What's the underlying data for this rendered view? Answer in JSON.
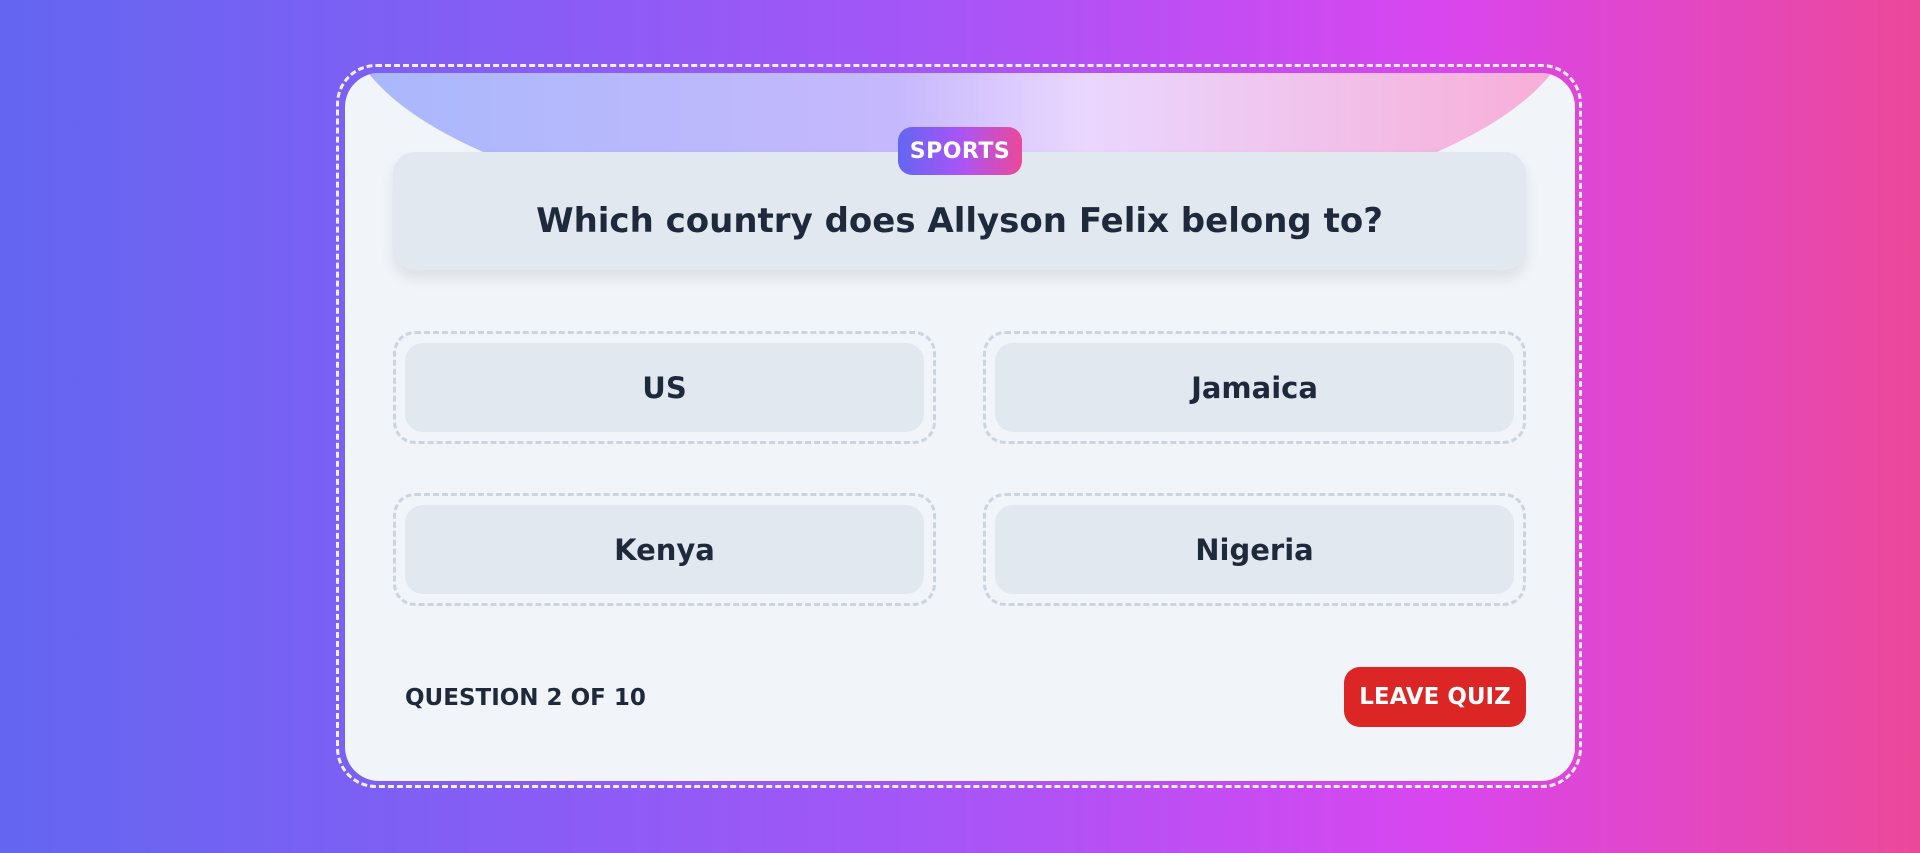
{
  "quiz": {
    "category": "SPORTS",
    "question": "Which country does Allyson Felix belong to?",
    "options": [
      {
        "label": "US"
      },
      {
        "label": "Jamaica"
      },
      {
        "label": "Kenya"
      },
      {
        "label": "Nigeria"
      }
    ],
    "progress": "QUESTION 2 OF 10",
    "leave_label": "LEAVE QUIZ"
  },
  "colors": {
    "accent_danger": "#dc2626",
    "card_bg": "#f1f5f9",
    "option_bg": "#e2e8f0",
    "text_dark": "#1e293b"
  }
}
